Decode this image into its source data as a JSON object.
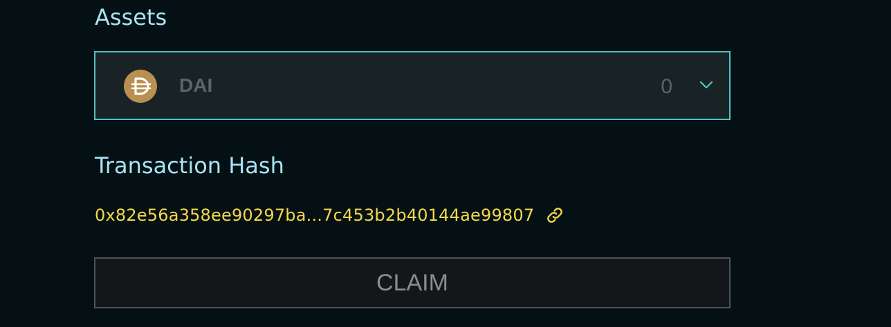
{
  "assets": {
    "label": "Assets",
    "selected": {
      "symbol": "DAI",
      "balance": "0",
      "icon": "dai-token-icon"
    },
    "dropdown_icon": "chevron-down-icon"
  },
  "transaction": {
    "label": "Transaction Hash",
    "hash": "0x82e56a358ee90297ba...7c453b2b40144ae99807",
    "link_icon": "link-icon"
  },
  "claim": {
    "label": "CLAIM"
  },
  "colors": {
    "background": "#051014",
    "label": "#a9e3f3",
    "accent_border": "#50c4c8",
    "hash": "#f5d84a",
    "dai_gold": "#b9904f"
  }
}
